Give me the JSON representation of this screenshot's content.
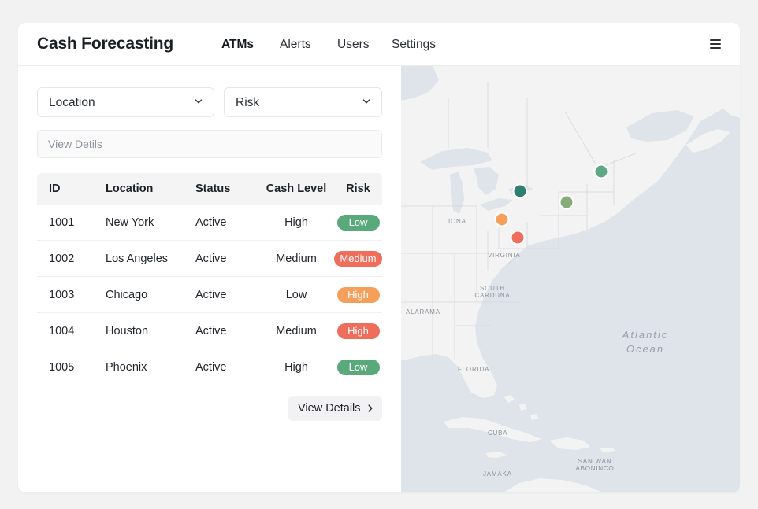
{
  "app": {
    "title": "Cash Forecasting"
  },
  "nav": [
    {
      "label": "ATMs",
      "active": true
    },
    {
      "label": "Alerts",
      "active": false
    },
    {
      "label": "Users",
      "active": false
    },
    {
      "label": "Settings",
      "active": false
    }
  ],
  "icons": {
    "menu": "hamburger-menu-icon",
    "dropdown": "chevron-down-icon",
    "next": "chevron-right-icon"
  },
  "filters": {
    "location": {
      "label": "Location"
    },
    "risk": {
      "label": "Risk"
    }
  },
  "search": {
    "placeholder": "View Detils",
    "value": ""
  },
  "table": {
    "headers": [
      "ID",
      "Location",
      "Status",
      "Cash Level",
      "Risk"
    ],
    "rows": [
      {
        "id": "1001",
        "location": "New York",
        "status": "Active",
        "cash_level": "High",
        "risk": "Low"
      },
      {
        "id": "1002",
        "location": "Los Angeles",
        "status": "Active",
        "cash_level": "Medium",
        "risk": "Medium"
      },
      {
        "id": "1003",
        "location": "Chicago",
        "status": "Active",
        "cash_level": "Low",
        "risk": "High"
      },
      {
        "id": "1004",
        "location": "Houston",
        "status": "Active",
        "cash_level": "Medium",
        "risk": "High"
      },
      {
        "id": "1005",
        "location": "Phoenix",
        "status": "Active",
        "cash_level": "High",
        "risk": "Low"
      }
    ]
  },
  "risk_colors": {
    "Low": "#5aa97b",
    "Medium": "#ee6d5b",
    "High": "#f4a05c"
  },
  "risk_colors_row": [
    "#5aa97b",
    "#ee6d5b",
    "#f4a05c",
    "#ee6d5b",
    "#5aa97b"
  ],
  "actions": {
    "view_details": "View Details"
  },
  "map": {
    "labels": {
      "iona": "IONA",
      "virginia": "VIRGINIA",
      "south_carolina_1": "SOUTH",
      "south_carolina_2": "CARDUNA",
      "alabama": "ALARAMA",
      "florida": "FLORIDA",
      "cuba": "CUBA",
      "jamaica": "JAMAKA",
      "san_juan_1": "SAN WAN",
      "san_juan_2": "ABONINCO",
      "ocean_1": "Atlantic",
      "ocean_2": "Ocean"
    },
    "marker_colors": [
      "#2f7f6f",
      "#5fa884",
      "#86ad78",
      "#f4a05c",
      "#ee6d5b"
    ],
    "land_color": "#f3f3f3",
    "water_color": "#dfe3ea"
  }
}
